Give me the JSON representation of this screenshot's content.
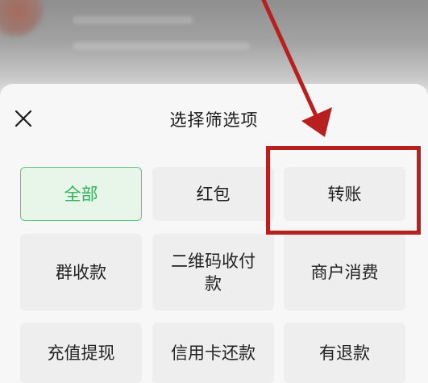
{
  "sheet": {
    "title": "选择筛选项",
    "close_icon": "close-icon"
  },
  "options": [
    {
      "label": "全部",
      "selected": true
    },
    {
      "label": "红包",
      "selected": false
    },
    {
      "label": "转账",
      "selected": false,
      "highlighted": true
    },
    {
      "label": "群收款",
      "selected": false
    },
    {
      "label": "二维码收付款",
      "selected": false
    },
    {
      "label": "商户消费",
      "selected": false
    },
    {
      "label": "充值提现",
      "selected": false
    },
    {
      "label": "信用卡还款",
      "selected": false
    },
    {
      "label": "有退款",
      "selected": false
    }
  ],
  "colors": {
    "selected_text": "#2fb45a",
    "selected_border": "#5fc77d",
    "annotation_red": "#b81f1f"
  }
}
